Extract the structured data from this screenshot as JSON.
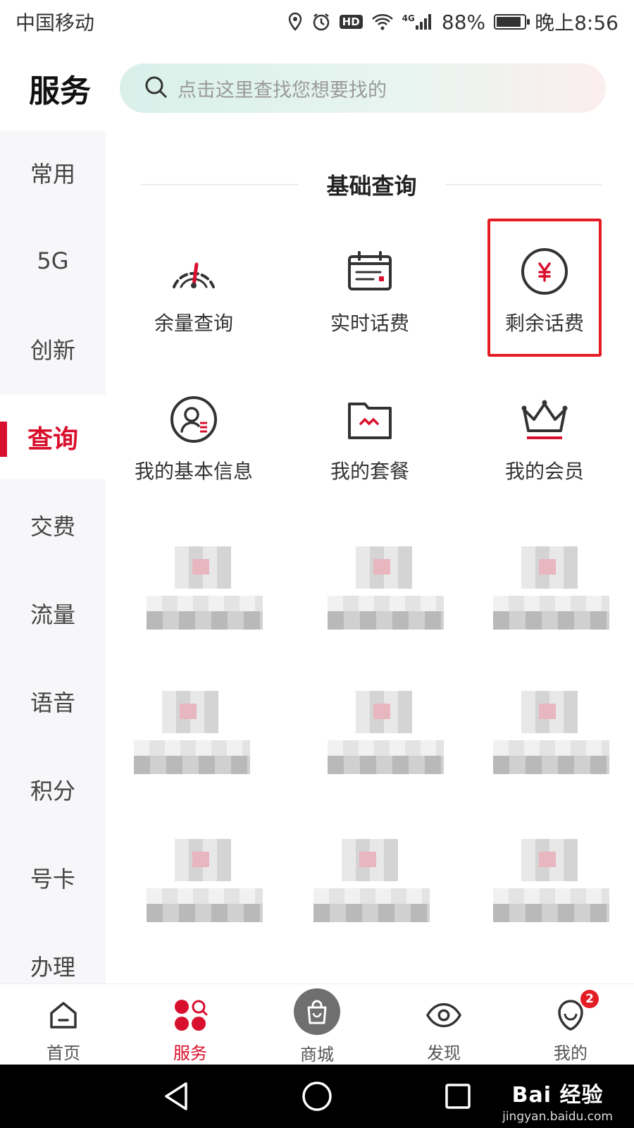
{
  "status_bar": {
    "carrier": "中国移动",
    "hd": "HD",
    "network": "4G",
    "battery": "88%",
    "battery_level": 0.88,
    "time": "晚上8:56"
  },
  "header": {
    "title": "服务",
    "search_placeholder": "点击这里查找您想要找的"
  },
  "sidebar": {
    "items": [
      {
        "label": "常用",
        "active": false
      },
      {
        "label": "5G",
        "active": false
      },
      {
        "label": "创新",
        "active": false
      },
      {
        "label": "查询",
        "active": true
      },
      {
        "label": "交费",
        "active": false
      },
      {
        "label": "流量",
        "active": false
      },
      {
        "label": "语音",
        "active": false
      },
      {
        "label": "积分",
        "active": false
      },
      {
        "label": "号卡",
        "active": false
      },
      {
        "label": "办理",
        "active": false
      }
    ]
  },
  "section": {
    "title": "基础查询",
    "items": [
      {
        "label": "余量查询",
        "icon": "gauge-icon"
      },
      {
        "label": "实时话费",
        "icon": "bill-calendar-icon"
      },
      {
        "label": "剩余话费",
        "icon": "yuan-coin-icon",
        "highlighted": true
      },
      {
        "label": "我的基本信息",
        "icon": "user-profile-icon"
      },
      {
        "label": "我的套餐",
        "icon": "package-folder-icon"
      },
      {
        "label": "我的会员",
        "icon": "crown-icon"
      }
    ]
  },
  "bottom_nav": {
    "items": [
      {
        "label": "首页",
        "icon": "home-icon"
      },
      {
        "label": "服务",
        "icon": "service-grid-icon",
        "active": true
      },
      {
        "label": "商城",
        "icon": "shopping-bag-icon"
      },
      {
        "label": "发现",
        "icon": "eye-icon"
      },
      {
        "label": "我的",
        "icon": "profile-icon",
        "badge": "2"
      }
    ]
  },
  "watermark": {
    "main": "Bai 经验",
    "sub": "jingyan.baidu.com"
  },
  "colors": {
    "accent": "#d9102d",
    "highlight": "#e41c24"
  }
}
